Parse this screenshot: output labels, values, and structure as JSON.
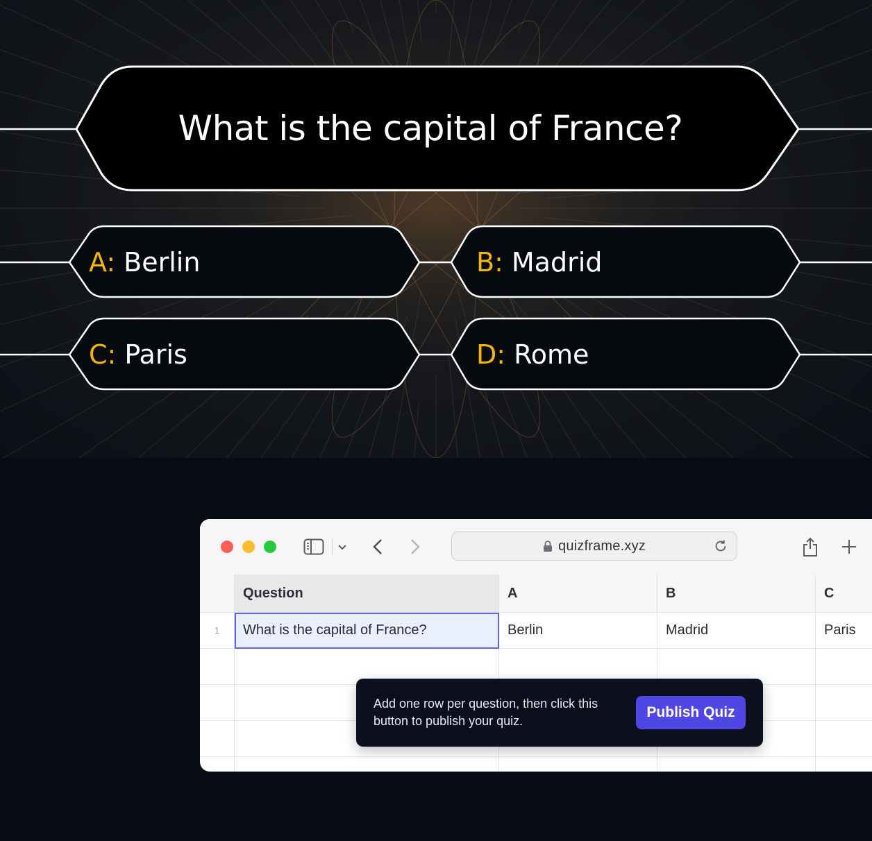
{
  "quiz": {
    "question": "What is the capital of France?",
    "answers": [
      {
        "letter": "A:",
        "text": "Berlin"
      },
      {
        "letter": "B:",
        "text": "Madrid"
      },
      {
        "letter": "C:",
        "text": "Paris"
      },
      {
        "letter": "D:",
        "text": "Rome"
      }
    ],
    "colors": {
      "letter": "#f2b705",
      "frame": "#ffffff",
      "panel": "#000000"
    }
  },
  "browser": {
    "address": "quizframe.xyz",
    "icons": [
      "close-dot",
      "minimize-dot",
      "zoom-dot",
      "sidebar-icon",
      "chevron-down-icon",
      "back-icon",
      "forward-icon",
      "lock-icon",
      "reload-icon",
      "share-icon",
      "new-tab-icon"
    ]
  },
  "sheet": {
    "headers": [
      "Question",
      "A",
      "B",
      "C"
    ],
    "rows": [
      {
        "num": "1",
        "cells": [
          "What is the capital of France?",
          "Berlin",
          "Madrid",
          "Paris"
        ]
      }
    ]
  },
  "tooltip": {
    "message": "Add one row per question, then click this button to publish your quiz.",
    "button": "Publish Quiz",
    "accent": "#4f46e5"
  }
}
